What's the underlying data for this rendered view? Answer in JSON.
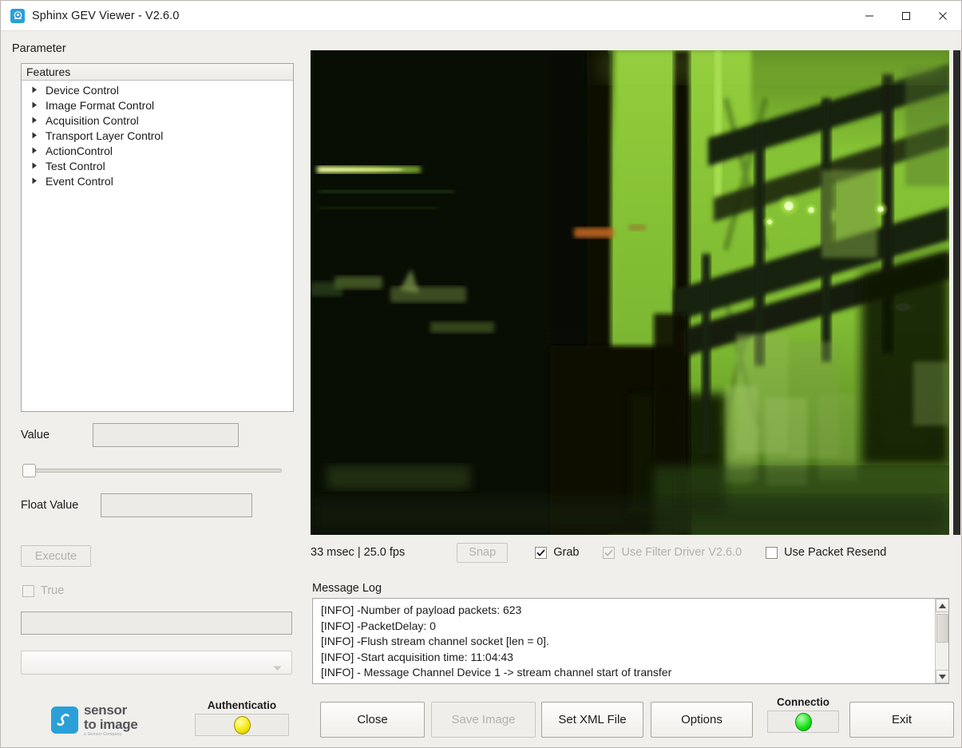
{
  "window": {
    "title": "Sphinx GEV Viewer -  V2.6.0",
    "icon": "app-logo-icon",
    "minimize": "minimize-icon",
    "maximize": "maximize-icon",
    "close": "close-icon"
  },
  "parameter": {
    "label": "Parameter",
    "tree_header": "Features",
    "items": [
      {
        "label": "Device Control"
      },
      {
        "label": "Image Format Control"
      },
      {
        "label": "Acquisition Control"
      },
      {
        "label": "Transport Layer Control"
      },
      {
        "label": "ActionControl"
      },
      {
        "label": "Test Control"
      },
      {
        "label": "Event Control"
      }
    ],
    "value_label": "Value",
    "value_text": "",
    "float_label": "Float Value",
    "float_text": "",
    "slider_position": 0,
    "execute_label": "Execute",
    "execute_enabled": false,
    "true_label": "True",
    "true_checked": false,
    "true_enabled": false,
    "string_text": "",
    "combo_selected": ""
  },
  "viewer": {
    "status_text": "33 msec | 25.0 fps",
    "snap_label": "Snap",
    "snap_enabled": false,
    "grab_label": "Grab",
    "grab_checked": true,
    "filter_label": "Use Filter Driver V2.6.0",
    "filter_checked": true,
    "filter_enabled": false,
    "resend_label": "Use Packet Resend",
    "resend_checked": false
  },
  "log": {
    "label": "Message Log",
    "lines": [
      "[INFO] -Number of payload packets: 623",
      "[INFO] -PacketDelay: 0",
      "[INFO] -Flush stream channel socket [len = 0].",
      "[INFO] -Start acquisition time: 11:04:43",
      "[INFO] - Message Channel Device 1 -> stream channel start of transfer"
    ],
    "scroll_up": "scroll-up-icon",
    "scroll_down": "scroll-down-icon"
  },
  "branding": {
    "logo_line1": "sensor",
    "logo_line2": "to image",
    "logo_tagline": "a Sensor Company"
  },
  "leds": {
    "auth_caption": "Authenticatio",
    "auth_color": "#f5e400",
    "connection_caption": "Connectio",
    "connection_color": "#16e016"
  },
  "buttons": {
    "close": "Close",
    "save_image": "Save Image",
    "save_image_enabled": false,
    "set_xml_file": "Set XML File",
    "options": "Options",
    "exit": "Exit"
  }
}
